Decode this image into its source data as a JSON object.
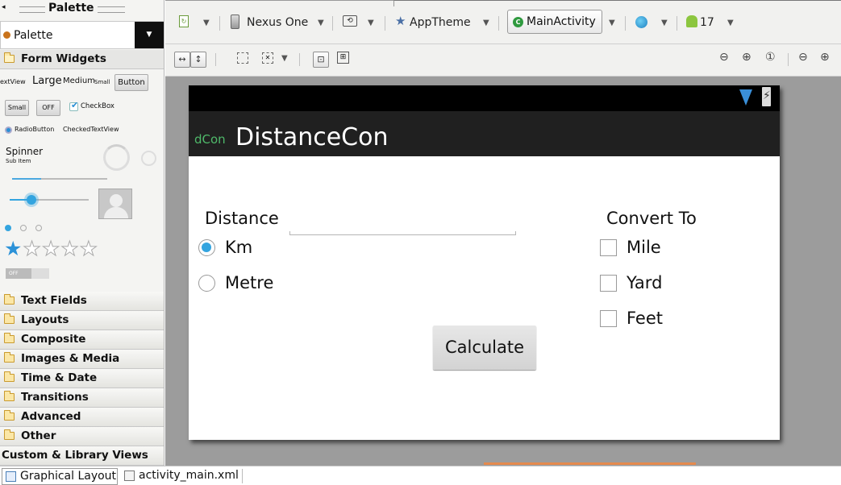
{
  "palette": {
    "title": "Palette",
    "dropdown_value": "Palette",
    "categories": [
      "Form Widgets",
      "Text Fields",
      "Layouts",
      "Composite",
      "Images & Media",
      "Time & Date",
      "Transitions",
      "Advanced",
      "Other",
      "Custom & Library Views"
    ],
    "form_widgets": {
      "textview": "extView",
      "large": "Large",
      "medium": "Medium",
      "small": "Small",
      "button": "Button",
      "small_button": "Small",
      "toggle": "OFF",
      "checkbox": "CheckBox",
      "radiobutton": "RadioButton",
      "checkedtextview": "CheckedTextView",
      "spinner": "Spinner",
      "spinner_sub": "Sub Item",
      "switch_label": "OFF"
    }
  },
  "toolbar": {
    "device": "Nexus One",
    "theme": "AppTheme",
    "activity": "MainActivity",
    "api_level": "17"
  },
  "device_preview": {
    "app_icon_text": "dCon",
    "app_title": "DistanceCon",
    "distance_label": "Distance",
    "convert_to_label": "Convert To",
    "radio_options": [
      {
        "label": "Km",
        "checked": true
      },
      {
        "label": "Metre",
        "checked": false
      }
    ],
    "checkbox_options": [
      {
        "label": "Mile",
        "checked": false
      },
      {
        "label": "Yard",
        "checked": false
      },
      {
        "label": "Feet",
        "checked": false
      }
    ],
    "calculate_button": "Calculate"
  },
  "bottom_tabs": [
    {
      "label": "Graphical Layout",
      "active": true
    },
    {
      "label": "activity_main.xml",
      "active": false
    }
  ],
  "colors": {
    "accent_blue": "#33a4df",
    "action_bar": "#202020",
    "canvas": "#9c9c9c",
    "app_icon_green": "#4fb96a"
  }
}
